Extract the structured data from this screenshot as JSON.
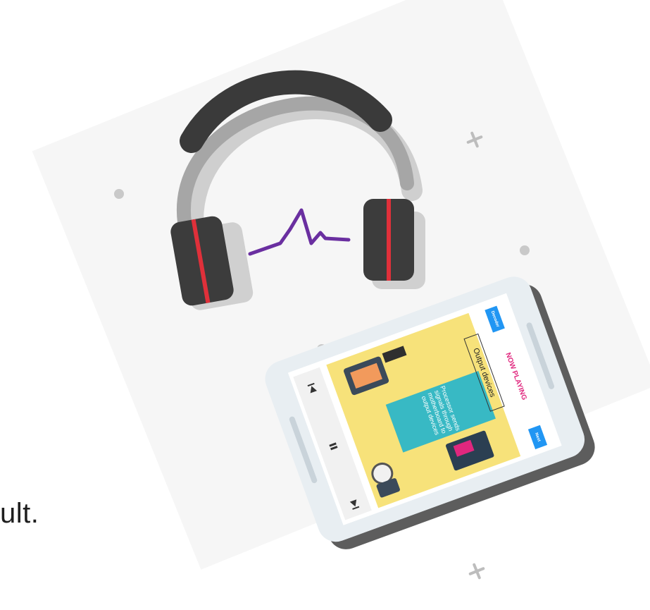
{
  "side_text": "ult.",
  "phone": {
    "top_left_button": "Decoder",
    "now_playing": "NOW PLAYING",
    "top_right_button": "Next",
    "card_title": "Output devices",
    "card_body_lines": [
      "Processor sends",
      "signals through",
      "motherboard to",
      "output devices"
    ],
    "controls": {
      "previous_icon": "skip-previous-icon",
      "pause_icon": "pause-icon",
      "next_icon": "skip-next-icon"
    }
  },
  "colors": {
    "headphone_band": "#3a3a3a",
    "headphone_frame": "#9e9e9e",
    "accent_red": "#e0303a",
    "pulse_purple": "#6a2fa0",
    "phone_body": "#e8eef2",
    "card_yellow": "#f7e27a",
    "card_teal": "#38b9c4",
    "accent_blue": "#2196f3",
    "accent_pink": "#e0277e"
  }
}
